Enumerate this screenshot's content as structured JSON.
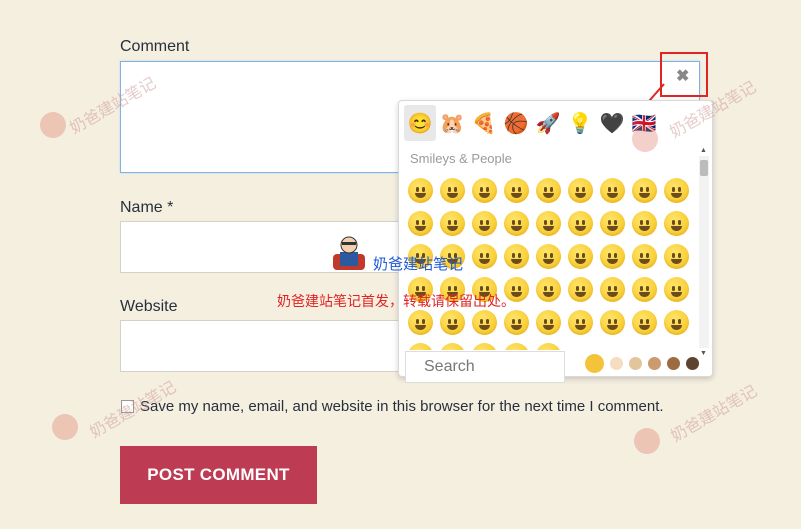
{
  "form": {
    "comment_label": "Comment",
    "name_label": "Name *",
    "website_label": "Website",
    "save_label": "Save my name, email, and website in this browser for the next time I comment.",
    "submit_label": "POST COMMENT",
    "close_glyph": "✖"
  },
  "emoji_picker": {
    "tabs": [
      {
        "icon": "smiley-icon",
        "glyph": "😊"
      },
      {
        "icon": "hamster-icon",
        "glyph": "🐹"
      },
      {
        "icon": "pizza-icon",
        "glyph": "🍕"
      },
      {
        "icon": "basketball-icon",
        "glyph": "🏀"
      },
      {
        "icon": "rocket-icon",
        "glyph": "🚀"
      },
      {
        "icon": "lightbulb-icon",
        "glyph": "💡"
      },
      {
        "icon": "heart-icon",
        "glyph": "🖤"
      },
      {
        "icon": "flag-icon",
        "glyph": "🇬🇧"
      }
    ],
    "category_title": "Smileys & People",
    "search_placeholder": "Search",
    "skin_tones": [
      "#f5c33b",
      "#f6dcc0",
      "#e3c59c",
      "#c99b6e",
      "#9c6b42",
      "#5d4431"
    ]
  },
  "watermark": {
    "text": "奶爸建站笔记",
    "notice": "奶爸建站笔记首发，转载请保留出处。"
  }
}
